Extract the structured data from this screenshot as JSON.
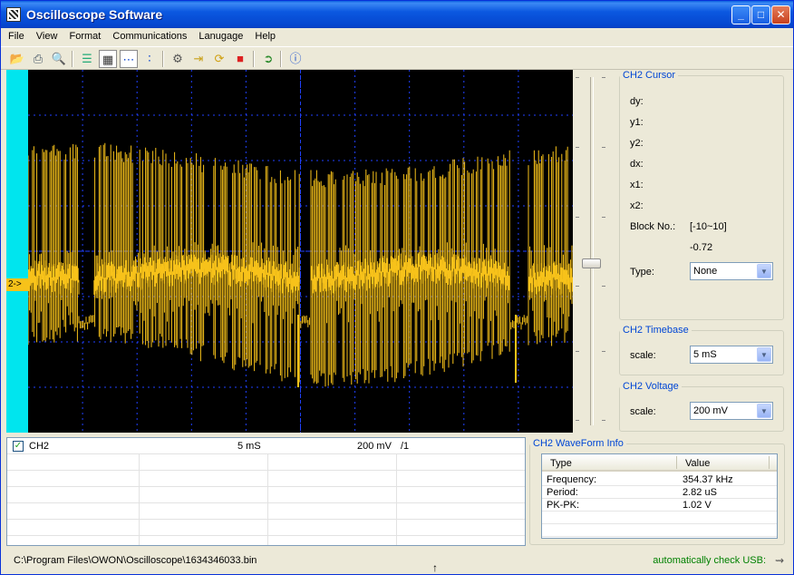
{
  "window": {
    "title": "Oscilloscope Software",
    "minimize": "_",
    "maximize": "□",
    "close": "✕"
  },
  "menu": [
    "File",
    "View",
    "Format",
    "Communications",
    "Lanugage",
    "Help"
  ],
  "scope": {
    "channel_marker": "2->",
    "trace_color": "#f7c21a",
    "grid_color": "#2040ff"
  },
  "cursor_panel": {
    "legend": "CH2 Cursor",
    "dy": "dy:",
    "y1": "y1:",
    "y2": "y2:",
    "dx": "dx:",
    "x1": "x1:",
    "x2": "x2:",
    "block_label": "Block No.:",
    "block_range": "[-10~10]",
    "block_value": "-0.72",
    "type_label": "Type:",
    "type_value": "None"
  },
  "timebase_panel": {
    "legend": "CH2 Timebase",
    "scale_label": "scale:",
    "scale_value": "5  mS"
  },
  "voltage_panel": {
    "legend": "CH2 Voltage",
    "scale_label": "scale:",
    "scale_value": "200 mV"
  },
  "channel_list": {
    "checked": "✓",
    "name": "CH2",
    "timebase": "5  mS",
    "voltage": "200 mV",
    "probe": "/1"
  },
  "waveform_info": {
    "legend": "CH2 WaveForm Info",
    "col_type": "Type",
    "col_value": "Value",
    "rows": [
      {
        "type": "Frequency:",
        "value": "354.37 kHz"
      },
      {
        "type": "Period:",
        "value": "2.82 uS"
      },
      {
        "type": "PK-PK:",
        "value": "1.02 V"
      }
    ]
  },
  "status": {
    "path": "C:\\Program Files\\OWON\\Oscilloscope\\1634346033.bin",
    "usb": "automatically check USB:"
  }
}
